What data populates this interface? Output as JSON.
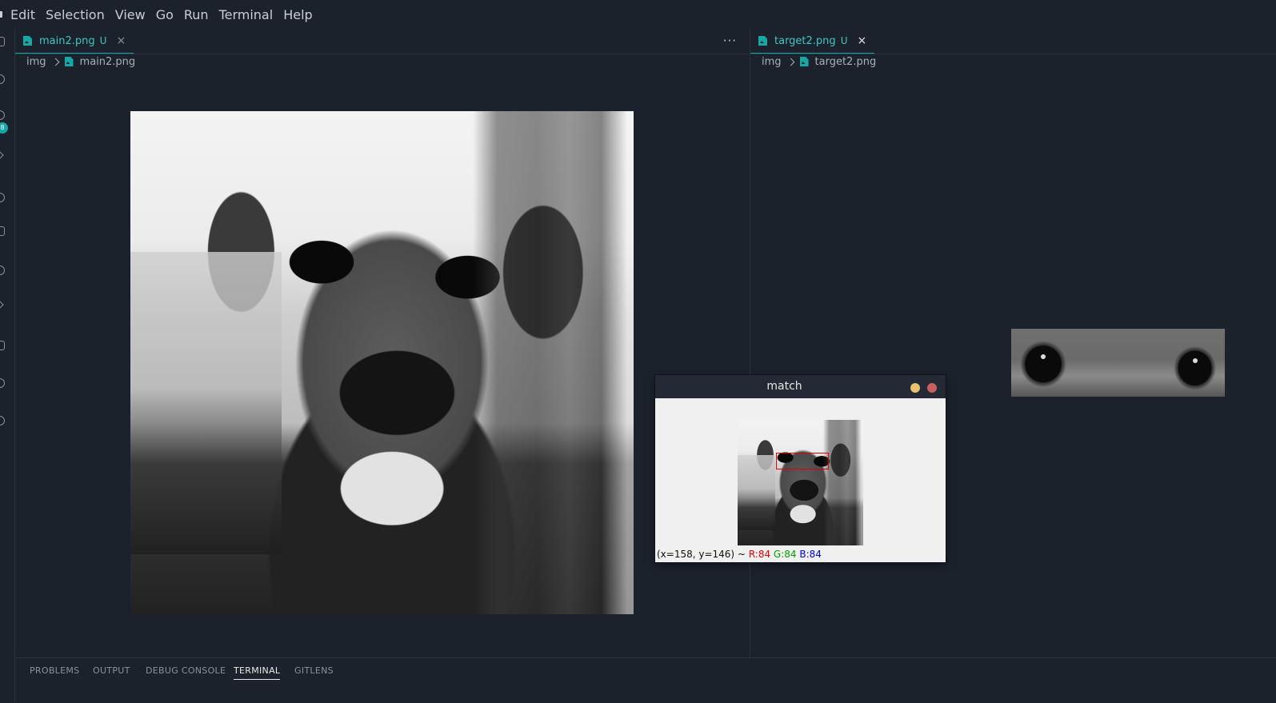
{
  "menubar": {
    "items": [
      "Edit",
      "Selection",
      "View",
      "Go",
      "Run",
      "Terminal",
      "Help"
    ]
  },
  "activity": {
    "badge": "8"
  },
  "editor_left": {
    "tab": {
      "label": "main2.png",
      "status": "U",
      "close": "×"
    },
    "more": "···",
    "breadcrumb": {
      "folder": "img",
      "file": "main2.png"
    }
  },
  "editor_right": {
    "tab": {
      "label": "target2.png",
      "status": "U",
      "close": "×"
    },
    "breadcrumb": {
      "folder": "img",
      "file": "target2.png"
    }
  },
  "match_window": {
    "title": "match",
    "status": {
      "coords": "(x=158, y=146) ~",
      "r": "R:84",
      "g": "G:84",
      "b": "B:84"
    }
  },
  "panel": {
    "tabs": [
      "PROBLEMS",
      "OUTPUT",
      "DEBUG CONSOLE",
      "TERMINAL",
      "GITLENS"
    ],
    "active_tab": "TERMINAL"
  },
  "colors": {
    "accent": "#16a7a7",
    "background": "#1b222c",
    "match_rect": "#e00000"
  }
}
